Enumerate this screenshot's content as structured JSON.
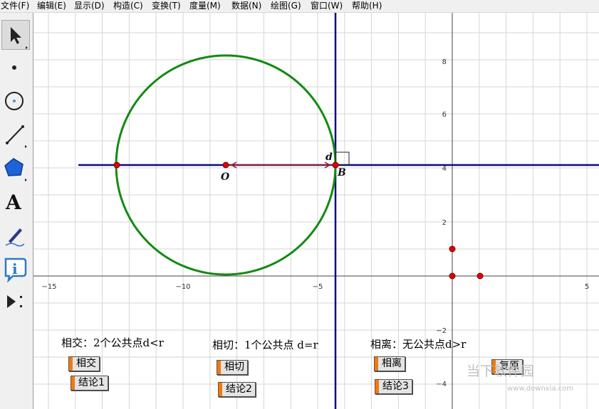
{
  "menu": [
    {
      "label": "文件(F)"
    },
    {
      "label": "编辑(E)"
    },
    {
      "label": "显示(D)"
    },
    {
      "label": "构造(C)"
    },
    {
      "label": "变换(T)"
    },
    {
      "label": "度量(M)"
    },
    {
      "label": "数据(N)"
    },
    {
      "label": "绘图(G)"
    },
    {
      "label": "窗口(W)"
    },
    {
      "label": "帮助(H)"
    }
  ],
  "tools": [
    {
      "name": "arrow-select-icon"
    },
    {
      "name": "point-tool-icon"
    },
    {
      "name": "compass-tool-icon"
    },
    {
      "name": "straightedge-tool-icon"
    },
    {
      "name": "polygon-tool-icon"
    },
    {
      "name": "text-tool-icon",
      "glyph": "A"
    },
    {
      "name": "marker-tool-icon"
    },
    {
      "name": "information-tool-icon",
      "glyph": "i"
    },
    {
      "name": "custom-tool-icon"
    }
  ],
  "axes": {
    "x_ticks": [
      "−15",
      "−10",
      "−5",
      "5"
    ],
    "y_ticks": [
      "8",
      "6",
      "4",
      "2",
      "−2",
      "−4"
    ]
  },
  "points": {
    "O": "O",
    "B": "B",
    "d": "d"
  },
  "captions": {
    "intersect": "相交：2个公共点d<r",
    "tangent": "相切：1个公共点 d=r",
    "separate": "相离：无公共点d>r"
  },
  "buttons": {
    "intersect": "相交",
    "conclusion1": "结论1",
    "tangent": "相切",
    "conclusion2": "结论2",
    "separate": "相离",
    "conclusion3": "结论3",
    "restore": "复原"
  },
  "colors": {
    "circle": "#138a13",
    "line": "#0b0b80",
    "segment": "#8b1a3a",
    "point": "#e00000",
    "button_handle": "#f07a10"
  },
  "watermark": {
    "brand": "当下软件园",
    "url": "www.downxia.com"
  }
}
